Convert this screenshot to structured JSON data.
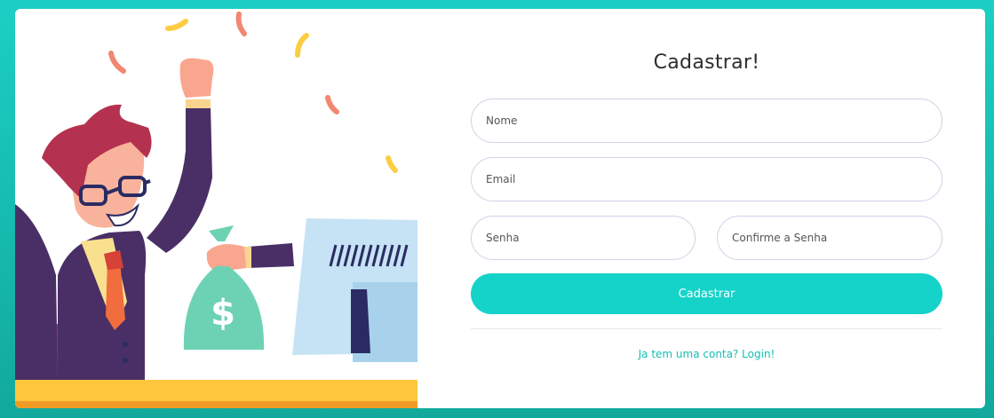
{
  "form": {
    "title": "Cadastrar!",
    "name_placeholder": "Nome",
    "email_placeholder": "Email",
    "password_placeholder": "Senha",
    "confirm_placeholder": "Confirme a Senha",
    "submit_label": "Cadastrar",
    "login_link": "Ja tem uma conta? Login!"
  },
  "illustration": {
    "icon": "happy-businessman-with-money-bag",
    "bag_symbol": "$"
  },
  "colors": {
    "background": "#1ccfc4",
    "accent": "#15d3c9",
    "link": "#15bdb3",
    "border": "#cfd3e6"
  }
}
